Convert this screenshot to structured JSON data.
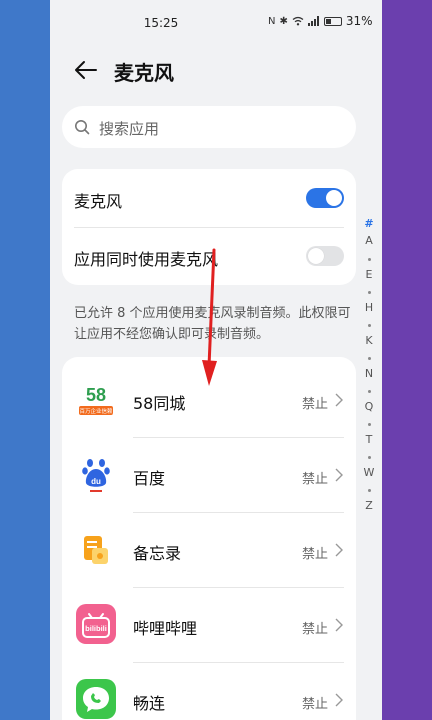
{
  "status_bar": {
    "time": "15:25",
    "icons": [
      "nfc-icon",
      "bluetooth-icon",
      "wifi-icon",
      "signal-icon",
      "battery-icon"
    ],
    "battery_percent": "31%"
  },
  "header": {
    "title": "麦克风"
  },
  "search": {
    "placeholder": "搜索应用"
  },
  "toggles": [
    {
      "label": "麦克风",
      "state": "on"
    },
    {
      "label": "应用同时使用麦克风",
      "state": "off"
    }
  ],
  "description": "已允许 8 个应用使用麦克风录制音频。此权限可让应用不经您确认即可录制音频。",
  "apps": [
    {
      "name": "58同城",
      "status": "禁止",
      "icon": "58-tongcheng-icon",
      "icon_badge": "58",
      "icon_caption": "百万企业信赖"
    },
    {
      "name": "百度",
      "status": "禁止",
      "icon": "baidu-icon",
      "icon_badge": "du"
    },
    {
      "name": "备忘录",
      "status": "禁止",
      "icon": "notes-icon"
    },
    {
      "name": "哔哩哔哩",
      "status": "禁止",
      "icon": "bilibili-icon",
      "icon_badge": "bilibili"
    },
    {
      "name": "畅连",
      "status": "禁止",
      "icon": "changlian-icon"
    }
  ],
  "index_bar": {
    "letters": [
      "#",
      "A",
      "E",
      "H",
      "K",
      "N",
      "Q",
      "T",
      "W",
      "Z"
    ],
    "active": "#"
  },
  "colors": {
    "accent": "#2b74e6",
    "background_left": "#3f78c9",
    "background_right": "#6b3fae",
    "annotation_arrow": "#e02020"
  }
}
